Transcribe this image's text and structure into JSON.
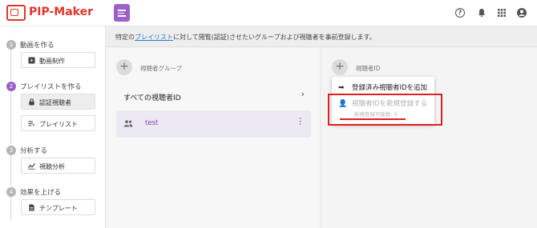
{
  "app": {
    "brand": "PIP-Maker"
  },
  "header": {
    "help_icon": "help-circle-icon",
    "bell_icon": "bell-icon",
    "apps_icon": "apps-grid-icon",
    "account_icon": "account-circle-icon"
  },
  "sidebar": {
    "steps": [
      {
        "num": "1",
        "label": "動画を作る",
        "items": [
          {
            "label": "動画制作",
            "icon": "video-library-icon"
          }
        ]
      },
      {
        "num": "2",
        "label": "プレイリストを作る",
        "items": [
          {
            "label": "認証視聴者",
            "icon": "lock-user-icon"
          },
          {
            "label": "プレイリスト",
            "icon": "playlist-icon"
          }
        ]
      },
      {
        "num": "3",
        "label": "分析する",
        "items": [
          {
            "label": "視聴分析",
            "icon": "analytics-icon"
          }
        ]
      },
      {
        "num": "4",
        "label": "効果を上げる",
        "items": [
          {
            "label": "テンプレート",
            "icon": "document-icon"
          }
        ]
      }
    ]
  },
  "notice": {
    "prefix": "特定の",
    "link": "プレイリスト",
    "suffix": "に対して閲覧(認証)させたいグループおよび視聴者を事前登録します。"
  },
  "groups": {
    "header": "視聴者グループ",
    "add_symbol": "+",
    "all_label": "すべての視聴者ID",
    "chevron": "›",
    "rows": [
      {
        "name": "test"
      }
    ],
    "more_symbol": "⋮"
  },
  "viewers": {
    "header": "視聴者ID",
    "add_symbol": "+",
    "menu": {
      "item1": "登録済み視聴者IDを追加",
      "item2": "視聴者IDを新規登録する",
      "item2_sub": "新規登録可能数: 0"
    }
  },
  "colors": {
    "accent": "#9c61c7",
    "brand": "#e0362c",
    "highlight": "#e02020"
  }
}
